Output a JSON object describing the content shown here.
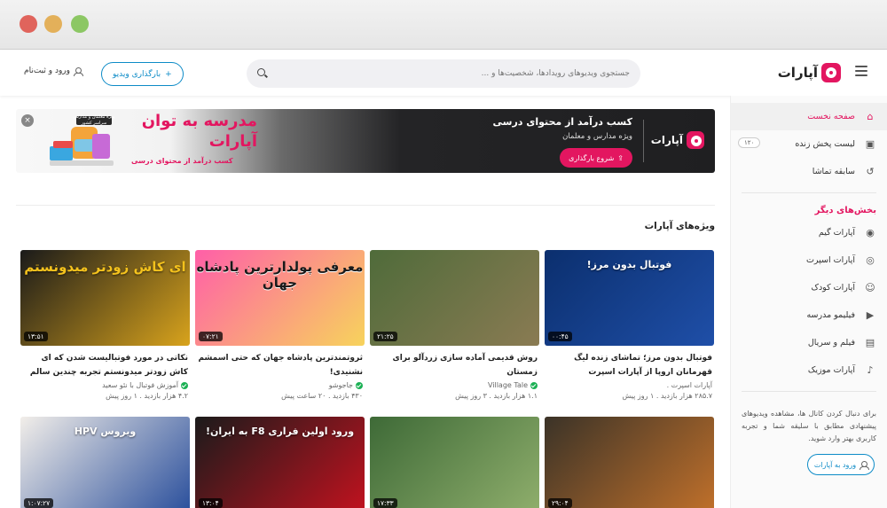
{
  "header": {
    "logo_text": "آپارات",
    "search_placeholder": "جستجوی ویدیوهای رویدادها، شخصیت‌ها و ...",
    "upload_label": "بارگذاری ویدیو",
    "login_label": "ورود و ثبت‌نام"
  },
  "sidebar": {
    "items": [
      {
        "label": "صفحه نخست",
        "icon": "home-icon"
      },
      {
        "label": "لیست پخش زنده",
        "icon": "live-icon",
        "badge": "۱۲۰"
      },
      {
        "label": "سابقه تماشا",
        "icon": "history-icon"
      }
    ],
    "other_heading": "بخش‌های دیگر",
    "other_items": [
      {
        "label": "آپارات گیم",
        "icon": "game-icon"
      },
      {
        "label": "آپارات اسپرت",
        "icon": "sport-icon"
      },
      {
        "label": "آپارات کودک",
        "icon": "kids-icon"
      },
      {
        "label": "فیلیمو مدرسه",
        "icon": "school-icon"
      },
      {
        "label": "فیلم و سریال",
        "icon": "film-icon"
      },
      {
        "label": "آپارات موزیک",
        "icon": "music-icon"
      }
    ],
    "note": "برای دنبال کردن کانال ها، مشاهده ویدیوهای پیشنهادی مطابق با سلیقه شما و تجربه کاربری بهتر وارد شوید.",
    "login_button": "ورود به آپارات"
  },
  "banner": {
    "logo_text": "آپارات",
    "title": "کسب درآمد از محتوای درسی",
    "subtitle": "ویژه مدارس و معلمان",
    "button": "شروع بارگذاری",
    "headline": "مدرسه به توان آپارات",
    "caption": "کسب درآمد از محتوای درسی",
    "art_tag": "ویژه معلمان و مدارس سراسر کشور"
  },
  "section_title": "ویژه‌های آپارات",
  "videos": [
    {
      "title": "فوتبال بدون مرز؛ تماشای زنده لیگ قهرمانان اروپا از آپارات اسپرت",
      "channel": "آپارات اسپرت .",
      "verified": false,
      "views": "۲۸۵.۷ هزار بازدید",
      "age": "۱ روز پیش",
      "duration": "۰۰:۴۵",
      "thumb_text": "فوتبال بدون مرز!",
      "colors": [
        "#0b2f6e",
        "#1f4fa8"
      ]
    },
    {
      "title": "روش قدیمی آماده سازی زردآلو برای زمستان",
      "channel": "Village Tale",
      "verified": true,
      "views": "۱.۱ هزار بازدید",
      "age": "۳ روز پیش",
      "duration": "۲۱:۲۵",
      "thumb_text": "",
      "colors": [
        "#4f6b3a",
        "#8a7b53"
      ]
    },
    {
      "title": "ثروتمندترین پادشاه جهان که حتی اسمشم نشنیدی!",
      "channel": "جاجوشو",
      "verified": true,
      "views": "۴۳۰ بازدید",
      "age": "۲۰ ساعت پیش",
      "duration": "۰۷:۲۱",
      "thumb_text": "معرفی پولدارترین پادشاه جهان",
      "colors": [
        "#ff5fa8",
        "#f7d35c"
      ]
    },
    {
      "title": "نکاتی در مورد فوتبالیست شدن که ای کاش زودتر میدونستم  تجربه چندین سالم",
      "channel": "آموزش فوتبال با نئو سعید",
      "verified": true,
      "views": "۴.۲ هزار بازدید",
      "age": "۱ روز پیش",
      "duration": "۱۳:۵۱",
      "thumb_text": "ای کاش زودتر میدونستم",
      "colors": [
        "#1a1a1a",
        "#d8a31c"
      ]
    },
    {
      "title": "",
      "channel": "",
      "verified": false,
      "views": "",
      "age": "",
      "duration": "۲۹:۰۴",
      "thumb_text": "",
      "colors": [
        "#3b3328",
        "#c0702a"
      ]
    },
    {
      "title": "",
      "channel": "",
      "verified": false,
      "views": "",
      "age": "",
      "duration": "۱۷:۳۳",
      "thumb_text": "",
      "colors": [
        "#3e6a37",
        "#8fae6c"
      ]
    },
    {
      "title": "",
      "channel": "",
      "verified": false,
      "views": "",
      "age": "",
      "duration": "۱۳:۰۴",
      "thumb_text": "ورود اولین فراری F8 به ایران!",
      "colors": [
        "#1b1b1b",
        "#c1121f"
      ]
    },
    {
      "title": "",
      "channel": "",
      "verified": false,
      "views": "",
      "age": "",
      "duration": "۱:۰۷:۲۷",
      "thumb_text": "ویروس HPV",
      "colors": [
        "#f2eee9",
        "#2a4f9c"
      ]
    }
  ]
}
